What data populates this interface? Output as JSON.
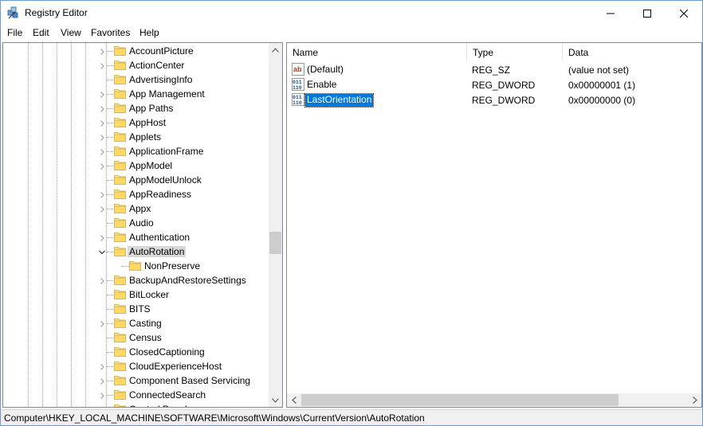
{
  "window": {
    "title": "Registry Editor"
  },
  "menu": [
    "File",
    "Edit",
    "View",
    "Favorites",
    "Help"
  ],
  "tree": {
    "items": [
      {
        "label": "AccountPicture",
        "expandable": true,
        "selected": false
      },
      {
        "label": "ActionCenter",
        "expandable": true,
        "selected": false
      },
      {
        "label": "AdvertisingInfo",
        "expandable": false,
        "selected": false
      },
      {
        "label": "App Management",
        "expandable": true,
        "selected": false
      },
      {
        "label": "App Paths",
        "expandable": true,
        "selected": false
      },
      {
        "label": "AppHost",
        "expandable": true,
        "selected": false
      },
      {
        "label": "Applets",
        "expandable": true,
        "selected": false
      },
      {
        "label": "ApplicationFrame",
        "expandable": true,
        "selected": false
      },
      {
        "label": "AppModel",
        "expandable": true,
        "selected": false
      },
      {
        "label": "AppModelUnlock",
        "expandable": false,
        "selected": false
      },
      {
        "label": "AppReadiness",
        "expandable": true,
        "selected": false
      },
      {
        "label": "Appx",
        "expandable": true,
        "selected": false
      },
      {
        "label": "Audio",
        "expandable": false,
        "selected": false
      },
      {
        "label": "Authentication",
        "expandable": true,
        "selected": false
      },
      {
        "label": "AutoRotation",
        "expandable": true,
        "expanded": true,
        "selected": true
      },
      {
        "label": "NonPreserve",
        "expandable": false,
        "selected": false,
        "child": true
      },
      {
        "label": "BackupAndRestoreSettings",
        "expandable": true,
        "selected": false
      },
      {
        "label": "BitLocker",
        "expandable": false,
        "selected": false
      },
      {
        "label": "BITS",
        "expandable": false,
        "selected": false
      },
      {
        "label": "Casting",
        "expandable": true,
        "selected": false
      },
      {
        "label": "Census",
        "expandable": false,
        "selected": false
      },
      {
        "label": "ClosedCaptioning",
        "expandable": false,
        "selected": false
      },
      {
        "label": "CloudExperienceHost",
        "expandable": true,
        "selected": false
      },
      {
        "label": "Component Based Servicing",
        "expandable": true,
        "selected": false
      },
      {
        "label": "ConnectedSearch",
        "expandable": true,
        "selected": false
      },
      {
        "label": "Control Panel",
        "expandable": true,
        "selected": false
      }
    ]
  },
  "list": {
    "columns": [
      "Name",
      "Type",
      "Data"
    ],
    "rows": [
      {
        "name": "(Default)",
        "type": "REG_SZ",
        "data": "(value not set)",
        "icon": "string-value-icon",
        "selected": false
      },
      {
        "name": "Enable",
        "type": "REG_DWORD",
        "data": "0x00000001 (1)",
        "icon": "binary-value-icon",
        "selected": false
      },
      {
        "name": "LastOrientation",
        "type": "REG_DWORD",
        "data": "0x00000000 (0)",
        "icon": "binary-value-icon",
        "selected": true
      }
    ]
  },
  "status": {
    "path": "Computer\\HKEY_LOCAL_MACHINE\\SOFTWARE\\Microsoft\\Windows\\CurrentVersion\\AutoRotation"
  },
  "colors": {
    "selection_blue": "#0078d7",
    "tree_selection_gray": "#d9d9d9",
    "folder_yellow": "#ffe8a6"
  }
}
